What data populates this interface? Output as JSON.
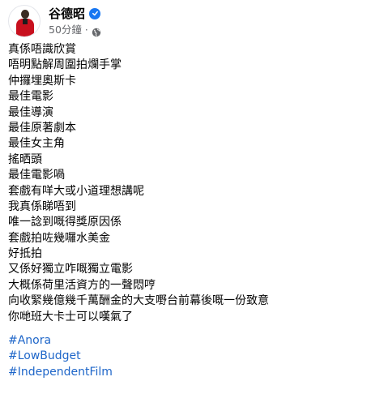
{
  "author": {
    "name": "谷德昭",
    "verified": true,
    "post_time": "50分鐘",
    "separator": "·",
    "audience_icon": "globe-icon",
    "verified_icon": "verified-badge-icon"
  },
  "post": {
    "lines": [
      "真係唔識欣賞",
      "唔明點解周圍拍爛手掌",
      "仲攞埋奧斯卡",
      "最佳電影",
      "最佳導演",
      "最佳原著劇本",
      "最佳女主角",
      "搖晒頭",
      "最佳電影喎",
      "套戲有咩大或小道理想講呢",
      "我真係睇唔到",
      "唯一諗到嘅得獎原因係",
      "套戲拍咗幾囉水美金",
      "好抵拍",
      "又係好獨立咋嘅獨立電影",
      "大概係荷里活資方的一聲悶哼",
      "向收緊幾億幾千萬酬金的大支嘢台前幕後嘅一份致意",
      "你哋班大卡士可以嘆氣了"
    ],
    "hashtags": [
      "#Anora",
      "#LowBudget",
      "#IndependentFilm"
    ]
  },
  "colors": {
    "text": "#050505",
    "muted": "#65676b",
    "link": "#1e66c9",
    "verified": "#1877f2",
    "avatar_jacket": "#c8101e"
  }
}
